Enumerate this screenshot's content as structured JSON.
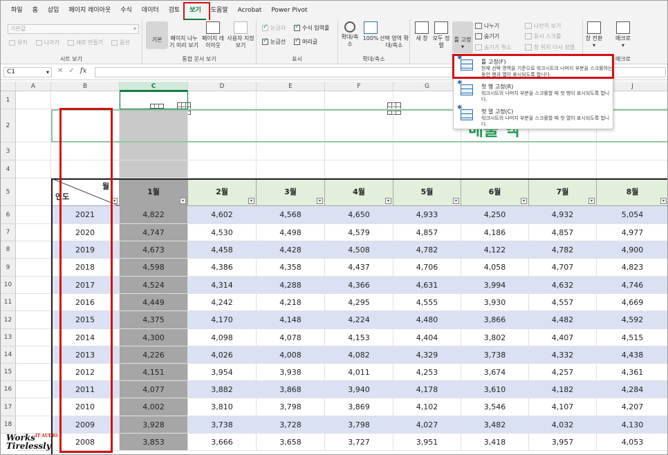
{
  "menu": [
    "파일",
    "홈",
    "삽입",
    "페이지 레이아웃",
    "수식",
    "데이터",
    "검토",
    "보기",
    "도움말",
    "Acrobat",
    "Power Pivot"
  ],
  "active_menu": "보기",
  "ribbon": {
    "sheet_view": {
      "dropdown_value": "기본값",
      "buttons": [
        "유지",
        "나가기",
        "새로 만들기",
        "옵션"
      ],
      "label": "시트 보기"
    },
    "workbook_views": {
      "buttons": [
        "기본",
        "페이지 나누기 미리 보기",
        "페이지 레이아웃",
        "사용자 지정 보기"
      ],
      "label": "통합 문서 보기"
    },
    "show": {
      "items": [
        {
          "label": "눈금자",
          "checked": true,
          "disabled": true
        },
        {
          "label": "수식 입력줄",
          "checked": true,
          "disabled": false
        },
        {
          "label": "눈금선",
          "checked": true,
          "disabled": false
        },
        {
          "label": "머리글",
          "checked": true,
          "disabled": false
        }
      ],
      "label": "표시"
    },
    "zoom": {
      "buttons": [
        "확대/축소",
        "100%",
        "선택 영역 확대/축소"
      ],
      "label": "확대/축소"
    },
    "window": {
      "big_buttons": [
        "새 창",
        "모두 정렬",
        "틀 고정"
      ],
      "small_buttons": [
        "나누기",
        "숨기기",
        "숨기기 취소"
      ],
      "disabled_buttons": [
        "나란히 보기",
        "동시 스크롤",
        "창 위치 다시 정렬"
      ],
      "switch_label": "창 전환"
    },
    "macro": {
      "button": "매크로",
      "label": "매크로"
    }
  },
  "freeze_menu": [
    {
      "title": "틀 고정(F)",
      "desc": "현재 선택 영역을 기준으로 워크시트의 나머지 부분을 스크롤하는 동안 행과 열이 표시되도록 합니다."
    },
    {
      "title": "첫 행 고정(R)",
      "desc": "워크시트의 나머지 부분을 스크롤할 때 첫 행이 표시되도록 합니다."
    },
    {
      "title": "첫 열 고정(C)",
      "desc": "워크시트의 나머지 부분을 스크롤할 때 첫 열이 표시되도록 합니다."
    }
  ],
  "formula_bar": {
    "name_box": "C1",
    "fx": "fx",
    "cancel": "✕",
    "enter": "✓"
  },
  "columns": [
    "A",
    "B",
    "C",
    "D",
    "E",
    "F",
    "G",
    "H",
    "I",
    "J"
  ],
  "selected_column": "C",
  "rows": [
    "1",
    "2",
    "3",
    "4",
    "5",
    "6",
    "7",
    "8",
    "9",
    "10",
    "11",
    "12",
    "13",
    "14",
    "15",
    "16",
    "17",
    "18"
  ],
  "title_fragment": "매출 액",
  "header_corner": {
    "top": "월",
    "bottom": "연도"
  },
  "months": [
    "1월",
    "2월",
    "3월",
    "4월",
    "5월",
    "6월",
    "7월",
    "8월"
  ],
  "table": [
    {
      "year": "2021",
      "values": [
        "4,822",
        "4,602",
        "4,568",
        "4,650",
        "4,933",
        "4,250",
        "4,932",
        "5,054"
      ]
    },
    {
      "year": "2020",
      "values": [
        "4,747",
        "4,530",
        "4,498",
        "4,579",
        "4,857",
        "4,186",
        "4,857",
        "4,977"
      ]
    },
    {
      "year": "2019",
      "values": [
        "4,673",
        "4,458",
        "4,428",
        "4,508",
        "4,782",
        "4,122",
        "4,782",
        "4,900"
      ]
    },
    {
      "year": "2018",
      "values": [
        "4,598",
        "4,386",
        "4,358",
        "4,437",
        "4,706",
        "4,058",
        "4,707",
        "4,823"
      ]
    },
    {
      "year": "2017",
      "values": [
        "4,524",
        "4,314",
        "4,288",
        "4,366",
        "4,631",
        "3,994",
        "4,632",
        "4,746"
      ]
    },
    {
      "year": "2016",
      "values": [
        "4,449",
        "4,242",
        "4,218",
        "4,295",
        "4,555",
        "3,930",
        "4,557",
        "4,669"
      ]
    },
    {
      "year": "2015",
      "values": [
        "4,375",
        "4,170",
        "4,148",
        "4,224",
        "4,480",
        "3,866",
        "4,482",
        "4,592"
      ]
    },
    {
      "year": "2014",
      "values": [
        "4,300",
        "4,098",
        "4,078",
        "4,153",
        "4,404",
        "3,802",
        "4,407",
        "4,515"
      ]
    },
    {
      "year": "2013",
      "values": [
        "4,226",
        "4,026",
        "4,008",
        "4,082",
        "4,329",
        "3,738",
        "4,332",
        "4,438"
      ]
    },
    {
      "year": "2012",
      "values": [
        "4,151",
        "3,954",
        "3,938",
        "4,011",
        "4,253",
        "3,674",
        "4,257",
        "4,361"
      ]
    },
    {
      "year": "2011",
      "values": [
        "4,077",
        "3,882",
        "3,868",
        "3,940",
        "4,178",
        "3,610",
        "4,182",
        "4,284"
      ]
    },
    {
      "year": "2010",
      "values": [
        "4,002",
        "3,810",
        "3,798",
        "3,869",
        "4,102",
        "3,546",
        "4,107",
        "4,207"
      ]
    },
    {
      "year": "2009",
      "values": [
        "3,928",
        "3,738",
        "3,728",
        "3,798",
        "4,027",
        "3,482",
        "4,032",
        "4,130"
      ]
    },
    {
      "year": "2008",
      "values": [
        "3,853",
        "3,666",
        "3,658",
        "3,727",
        "3,951",
        "3,418",
        "3,957",
        "4,053"
      ]
    }
  ],
  "watermark": {
    "line1": "Works",
    "sup": "IT AUDIO",
    "line2": "Tirelessly"
  },
  "colors": {
    "excel_green": "#107c41",
    "header_fill": "#e2efda",
    "band_fill": "#d9e1f2",
    "highlight_red": "#d21010",
    "selected_col": "#a6a6a6"
  }
}
